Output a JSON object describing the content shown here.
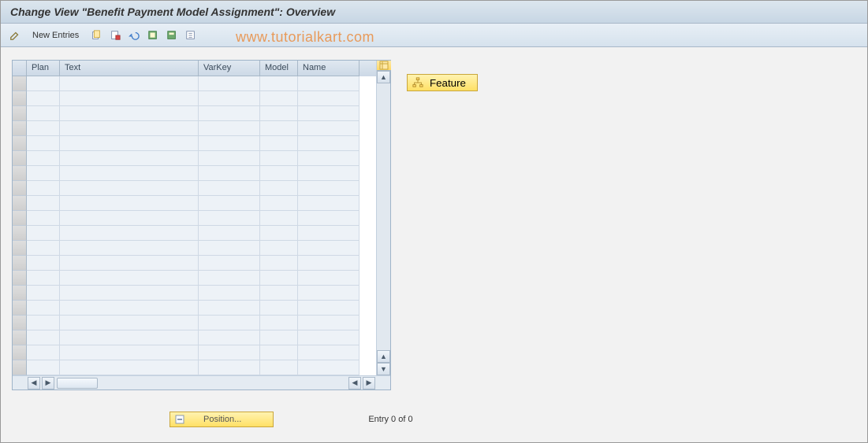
{
  "header": {
    "title": "Change View \"Benefit Payment Model Assignment\": Overview"
  },
  "toolbar": {
    "new_entries_label": "New Entries",
    "icons": {
      "edit": "edit-icon",
      "copy": "copy-icon",
      "delete": "delete-icon",
      "undo": "undo-icon",
      "select_all": "select-all-icon",
      "select_block": "select-block-icon",
      "deselect": "deselect-icon"
    }
  },
  "watermark": "www.tutorialkart.com",
  "grid": {
    "columns": [
      "Plan",
      "Text",
      "VarKey",
      "Model",
      "Name"
    ],
    "row_count": 20,
    "config_icon": "table-config-icon"
  },
  "feature_button": {
    "label": "Feature",
    "icon": "hierarchy-icon"
  },
  "footer": {
    "position_label": "Position...",
    "entry_text": "Entry 0 of 0"
  }
}
